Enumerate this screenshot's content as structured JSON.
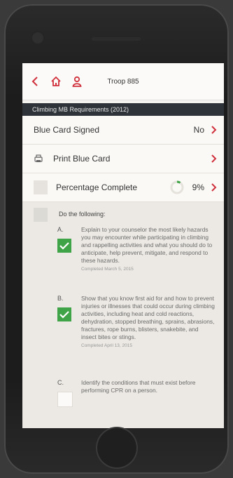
{
  "nav": {
    "title": "Troop 885"
  },
  "section_header": "Climbing MB Requirements (2012)",
  "rows": {
    "blue_card_signed": {
      "label": "Blue Card Signed",
      "value": "No"
    },
    "print_blue_card": {
      "label": "Print Blue Card"
    },
    "percentage_complete": {
      "label": "Percentage Complete",
      "value": "9%"
    }
  },
  "requirements": {
    "heading": "Do the following:",
    "items": [
      {
        "letter": "A.",
        "text": "Explain to your counselor the most likely hazards you may encounter while participating in climbing and rappelling activities and what you should do to anticipate, help prevent, mitigate, and respond to these hazards.",
        "date": "Completed March 5, 2015",
        "checked": true
      },
      {
        "letter": "B.",
        "text": "Show that you know first aid for and how to prevent injuries or illnesses that could occur during climbing activities, including heat and cold reactions, dehydration, stopped breathing, sprains, abrasions, fractures, rope burns, blisters, snakebite, and insect bites or stings.",
        "date": "Completed April 13, 2015",
        "checked": true
      },
      {
        "letter": "C.",
        "text": "Identify the conditions that must exist before performing CPR on a person.",
        "date": "",
        "checked": false
      }
    ]
  },
  "colors": {
    "accent": "#d0303c",
    "check_green": "#3fa447",
    "section_bg": "#2d3338"
  },
  "icons": {
    "back": "chevron-left-icon",
    "home": "home-icon",
    "profile": "person-icon",
    "print": "printer-icon"
  }
}
